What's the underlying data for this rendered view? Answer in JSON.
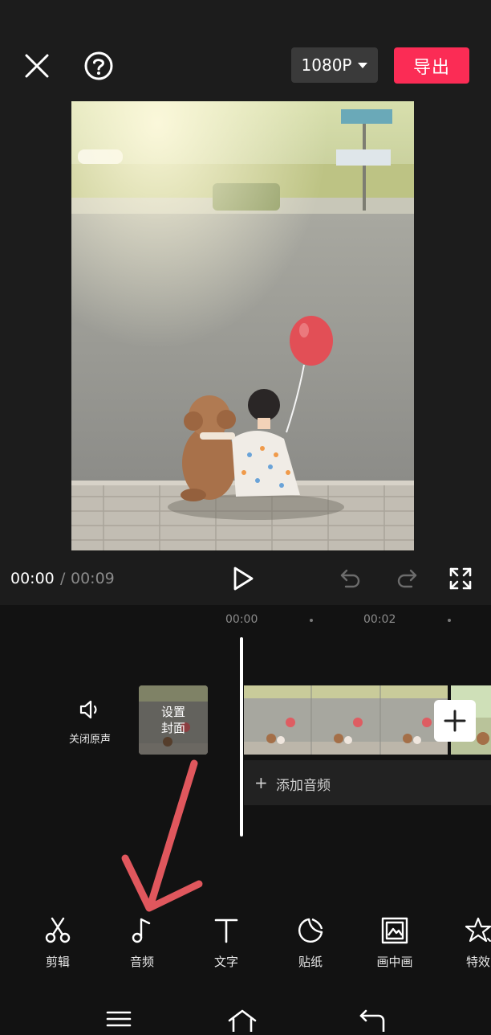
{
  "header": {
    "resolution_label": "1080P",
    "export_label": "导出"
  },
  "playback": {
    "current_time": "00:00",
    "separator": "/",
    "total_time": "00:09"
  },
  "timeline": {
    "ruler_marks": [
      "00:00",
      "00:02"
    ],
    "mute_label": "关闭原声",
    "cover_label_line1": "设置",
    "cover_label_line2": "封面",
    "add_audio_label": "添加音频"
  },
  "toolbar": {
    "items": [
      {
        "label": "剪辑",
        "icon": "scissors-icon"
      },
      {
        "label": "音频",
        "icon": "music-note-icon"
      },
      {
        "label": "文字",
        "icon": "text-icon"
      },
      {
        "label": "贴纸",
        "icon": "sticker-icon"
      },
      {
        "label": "画中画",
        "icon": "picture-in-picture-icon"
      },
      {
        "label": "特效",
        "icon": "effects-star-icon"
      }
    ]
  },
  "colors": {
    "accent": "#fb2c55",
    "annotation_arrow": "#e0575d"
  }
}
